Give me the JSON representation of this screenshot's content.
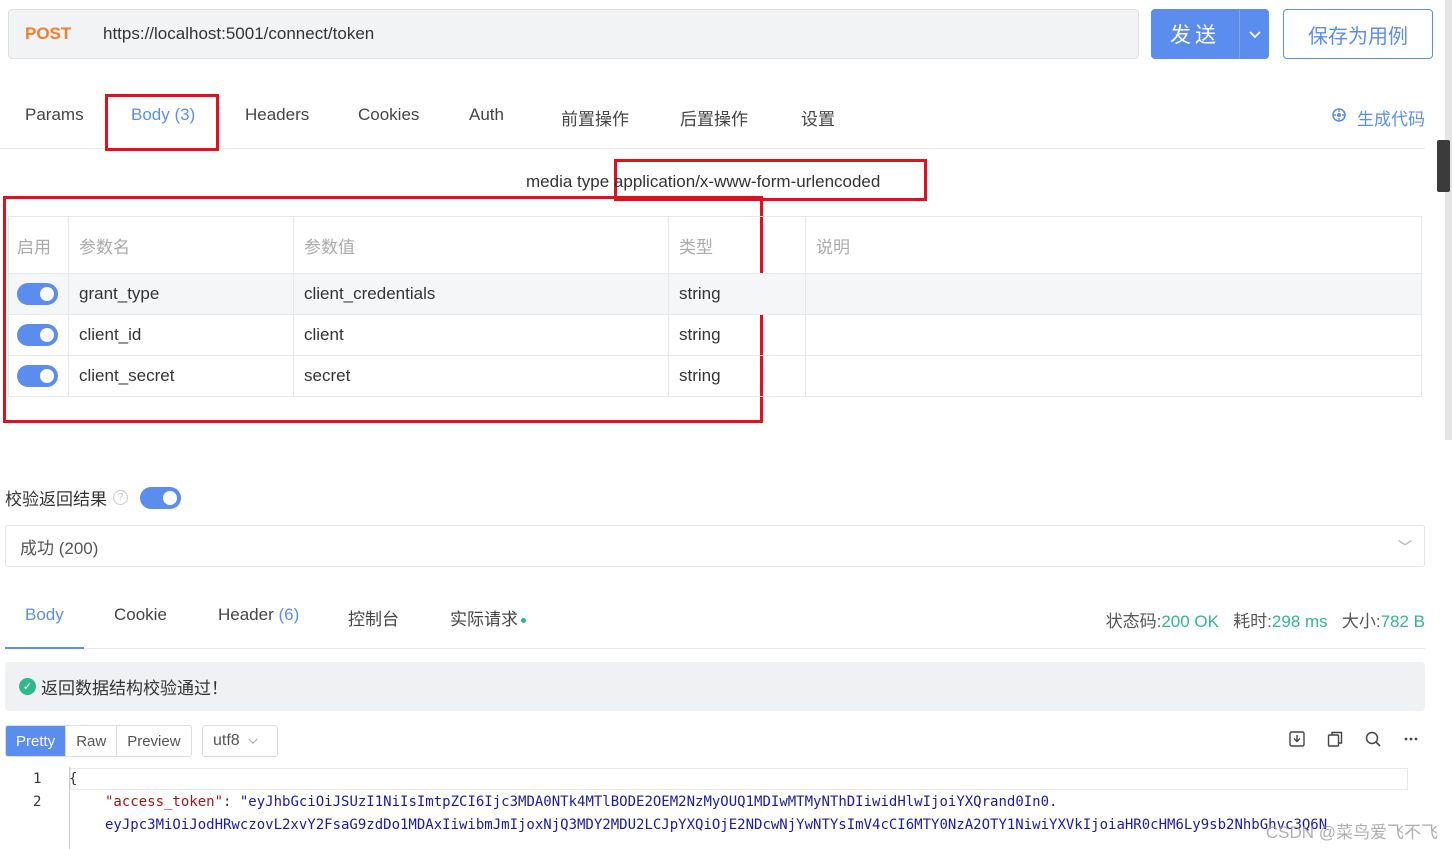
{
  "request": {
    "method": "POST",
    "url": "https://localhost:5001/connect/token",
    "send_label": "发送",
    "save_label": "保存为用例"
  },
  "req_tabs": {
    "params": "Params",
    "body": "Body",
    "body_count": "(3)",
    "headers": "Headers",
    "cookies": "Cookies",
    "auth": "Auth",
    "pre": "前置操作",
    "post": "后置操作",
    "settings": "设置",
    "generate_code": "生成代码"
  },
  "body": {
    "media_type_label": "media type",
    "media_type_value": "application/x-www-form-urlencoded",
    "columns": [
      "启用",
      "参数名",
      "参数值",
      "类型",
      "说明"
    ],
    "rows": [
      {
        "enabled": true,
        "name": "grant_type",
        "value": "client_credentials",
        "type": "string",
        "desc": ""
      },
      {
        "enabled": true,
        "name": "client_id",
        "value": "client",
        "type": "string",
        "desc": ""
      },
      {
        "enabled": true,
        "name": "client_secret",
        "value": "secret",
        "type": "string",
        "desc": ""
      }
    ]
  },
  "validate": {
    "label": "校验返回结果",
    "help": "?",
    "enabled": true,
    "selected": "成功 (200)"
  },
  "res_tabs": {
    "body": "Body",
    "cookie": "Cookie",
    "header": "Header",
    "header_count": "(6)",
    "console": "控制台",
    "actual": "实际请求"
  },
  "stats": {
    "status_label": "状态码:",
    "status_value": "200 OK",
    "time_label": "耗时:",
    "time_value": "298 ms",
    "size_label": "大小:",
    "size_value": "782 B"
  },
  "notice": "返回数据结构校验通过！",
  "format": {
    "pretty": "Pretty",
    "raw": "Raw",
    "preview": "Preview",
    "encoding": "utf8"
  },
  "code": {
    "line1_no": "1",
    "line2_no": "2",
    "line1": "{",
    "key": "\"access_token\"",
    "colon": ": ",
    "value_part1": "\"eyJhbGciOiJSUzI1NiIsImtpZCI6Ijc3MDA0NTk4MTlBODE2OEM2NzMyOUQ1MDIwMTMyNThDIiwidHlwIjoiYXQrand0In0.",
    "value_part2": "eyJpc3MiOiJodHRwczovL2xvY2FsaG9zdDo1MDAxIiwibmJmIjoxNjQ3MDY2MDU2LCJpYXQiOjE2NDcwNjYwNTYsImV4cCI6MTY0NzA2OTY1NiwiYXVkIjoiaHR0cHM6Ly9sb2NhbGhvc3Q6N"
  },
  "watermark": "CSDN @菜鸟爱飞不飞",
  "colors": {
    "accent": "#5b8def",
    "method": "#f57c29",
    "success": "#2fb98a",
    "highlight_box": "#e0101e"
  }
}
